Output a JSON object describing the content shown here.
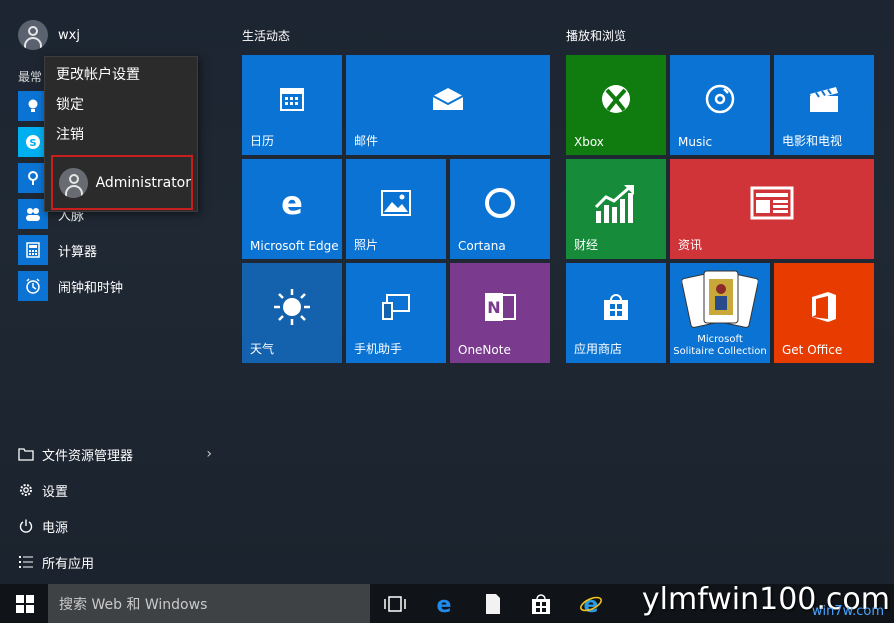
{
  "user": {
    "name": "wxj"
  },
  "left": {
    "most_used_label": "最常",
    "apps": [
      {
        "label": "",
        "icon": "lightbulb-icon"
      },
      {
        "label": "",
        "icon": "skype-icon"
      },
      {
        "label": "",
        "icon": "maps-icon"
      },
      {
        "label": "人脉",
        "icon": "people-icon"
      },
      {
        "label": "计算器",
        "icon": "calculator-icon"
      },
      {
        "label": "闹钟和时钟",
        "icon": "alarm-icon"
      }
    ],
    "bottom": [
      {
        "label": "文件资源管理器",
        "icon": "folder-icon"
      },
      {
        "label": "设置",
        "icon": "gear-icon"
      },
      {
        "label": "电源",
        "icon": "power-icon"
      },
      {
        "label": "所有应用",
        "icon": "list-icon"
      }
    ]
  },
  "popup": {
    "items": [
      "更改帐户设置",
      "锁定",
      "注销"
    ],
    "admin_label": "Administrator"
  },
  "groups": {
    "left_title": "生活动态",
    "right_title": "播放和浏览"
  },
  "tiles": {
    "calendar": "日历",
    "mail": "邮件",
    "edge": "Microsoft Edge",
    "photos": "照片",
    "cortana": "Cortana",
    "weather": "天气",
    "phone": "手机助手",
    "onenote": "OneNote",
    "xbox": "Xbox",
    "music": "Music",
    "movies": "电影和电视",
    "money": "财经",
    "news": "资讯",
    "store": "应用商店",
    "solitaire_line1": "Microsoft",
    "solitaire_line2": "Solitaire Collection",
    "office": "Get Office"
  },
  "taskbar": {
    "search_placeholder": "搜索 Web 和 Windows"
  },
  "watermark": {
    "main": "ylmfwin100.com",
    "sub": "win7w.com"
  },
  "colors": {
    "tile_blue": "#0a73d4",
    "tile_green": "#107c10",
    "tile_purple": "#7a3b8f",
    "tile_red": "#d13438",
    "tile_orange": "#e83b00",
    "highlight_red": "#c81e1e"
  }
}
